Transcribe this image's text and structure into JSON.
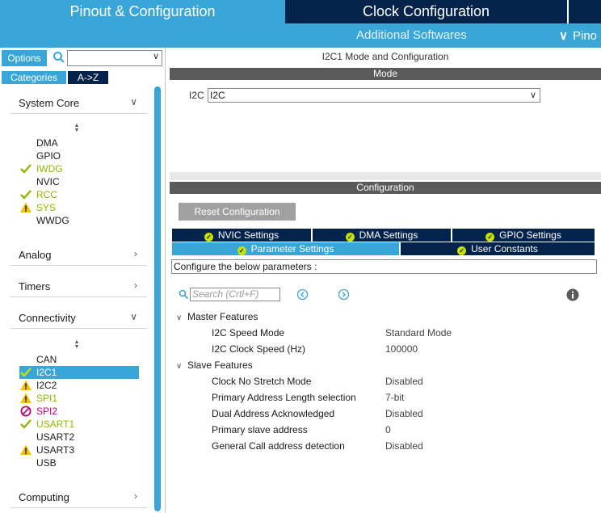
{
  "top_tabs": {
    "pinout": "Pinout & Configuration",
    "clock": "Clock Configuration"
  },
  "subbar": {
    "additional": "Additional Softwares",
    "pinout_view": "Pino"
  },
  "left": {
    "options_label": "Options",
    "categories_label": "Categories",
    "az_label": "A->Z",
    "sections": {
      "system_core": "System Core",
      "analog": "Analog",
      "timers": "Timers",
      "connectivity": "Connectivity",
      "computing": "Computing"
    },
    "system_core_items": [
      {
        "label": "DMA",
        "status": "none"
      },
      {
        "label": "GPIO",
        "status": "none"
      },
      {
        "label": "IWDG",
        "status": "ok"
      },
      {
        "label": "NVIC",
        "status": "none"
      },
      {
        "label": "RCC",
        "status": "ok"
      },
      {
        "label": "SYS",
        "status": "warning"
      },
      {
        "label": "WWDG",
        "status": "none"
      }
    ],
    "connectivity_items": [
      {
        "label": "CAN",
        "status": "none"
      },
      {
        "label": "I2C1",
        "status": "ok",
        "selected": true
      },
      {
        "label": "I2C2",
        "status": "warning"
      },
      {
        "label": "SPI1",
        "status": "warning"
      },
      {
        "label": "SPI2",
        "status": "disabled"
      },
      {
        "label": "USART1",
        "status": "ok"
      },
      {
        "label": "USART2",
        "status": "none"
      },
      {
        "label": "USART3",
        "status": "warning"
      },
      {
        "label": "USB",
        "status": "none"
      }
    ]
  },
  "right": {
    "title": "I2C1 Mode and Configuration",
    "mode_header": "Mode",
    "i2c_label": "I2C",
    "i2c_value": "I2C",
    "config_header": "Configuration",
    "reset_button": "Reset Configuration",
    "tabs": {
      "nvic": "NVIC Settings",
      "dma": "DMA Settings",
      "gpio": "GPIO Settings",
      "parameter": "Parameter Settings",
      "user_constants": "User Constants"
    },
    "configure_text": "Configure the below parameters :",
    "search_placeholder": "Search (Crtl+F)",
    "groups": {
      "master": "Master Features",
      "slave": "Slave Features"
    },
    "master_params": [
      {
        "name": "I2C Speed Mode",
        "value": "Standard Mode"
      },
      {
        "name": "I2C Clock Speed (Hz)",
        "value": "100000"
      }
    ],
    "slave_params": [
      {
        "name": "Clock No Stretch Mode",
        "value": "Disabled"
      },
      {
        "name": "Primary Address Length selection",
        "value": "7-bit"
      },
      {
        "name": "Dual Address Acknowledged",
        "value": "Disabled"
      },
      {
        "name": "Primary slave address",
        "value": "0"
      },
      {
        "name": "General Call address detection",
        "value": "Disabled"
      }
    ]
  },
  "colors": {
    "accent": "#3aa6d8",
    "navy": "#03234b",
    "ok": "#8fb800",
    "disabled": "#c0007a"
  }
}
